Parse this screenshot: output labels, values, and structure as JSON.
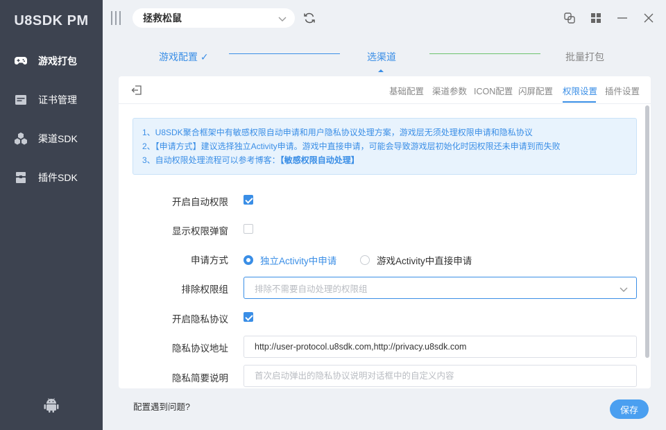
{
  "app": {
    "title": "U8SDK PM"
  },
  "sidebar": {
    "items": [
      {
        "label": "游戏打包",
        "icon": "gamepad-icon",
        "active": true
      },
      {
        "label": "证书管理",
        "icon": "certificate-icon",
        "active": false
      },
      {
        "label": "渠道SDK",
        "icon": "cubes-icon",
        "active": false
      },
      {
        "label": "插件SDK",
        "icon": "plugin-icon",
        "active": false
      }
    ],
    "bottom_icon": "android-icon"
  },
  "topbar": {
    "game_select": {
      "value": "拯救松鼠"
    },
    "window_buttons": [
      "restore-icon",
      "grid-icon",
      "minimize-icon",
      "close-icon"
    ]
  },
  "stepper": {
    "steps": [
      {
        "label": "游戏配置",
        "status": "done",
        "check": "✓"
      },
      {
        "label": "选渠道",
        "status": "current"
      },
      {
        "label": "批量打包",
        "status": "pending"
      }
    ]
  },
  "tabs": [
    {
      "label": "基础配置",
      "active": false
    },
    {
      "label": "渠道参数",
      "active": false
    },
    {
      "label": "ICON配置",
      "active": false
    },
    {
      "label": "闪屏配置",
      "active": false
    },
    {
      "label": "权限设置",
      "active": true
    },
    {
      "label": "插件设置",
      "active": false
    }
  ],
  "notice": {
    "line1": "1、U8SDK聚合框架中有敏感权限自动申请和用户隐私协议处理方案，游戏层无须处理权限申请和隐私协议",
    "line2": "2、【申请方式】建议选择独立Activity申请。游戏中直接申请，可能会导致游戏层初始化时因权限还未申请到而失败",
    "line3_prefix": "3、自动权限处理流程可以参考博客：",
    "line3_link": "【敏感权限自动处理】"
  },
  "form": {
    "auto_permission": {
      "label": "开启自动权限",
      "checked": true
    },
    "show_popup": {
      "label": "显示权限弹窗",
      "checked": false
    },
    "apply_mode": {
      "label": "申请方式",
      "options": [
        {
          "label": "独立Activity中申请",
          "selected": true
        },
        {
          "label": "游戏Activity中直接申请",
          "selected": false
        }
      ]
    },
    "exclude_groups": {
      "label": "排除权限组",
      "placeholder": "排除不需要自动处理的权限组"
    },
    "privacy_enable": {
      "label": "开启隐私协议",
      "checked": true
    },
    "privacy_url": {
      "label": "隐私协议地址",
      "value": "http://user-protocol.u8sdk.com,http://privacy.u8sdk.com"
    },
    "privacy_desc": {
      "label": "隐私简要说明",
      "placeholder": "首次启动弹出的隐私协议说明对话框中的自定义内容"
    }
  },
  "footer": {
    "question": "配置遇到问题?",
    "save_label": "保存"
  },
  "colors": {
    "accent": "#3a8ee6",
    "sidebar_bg": "#3d4350",
    "done_line": "#6cc36c"
  }
}
